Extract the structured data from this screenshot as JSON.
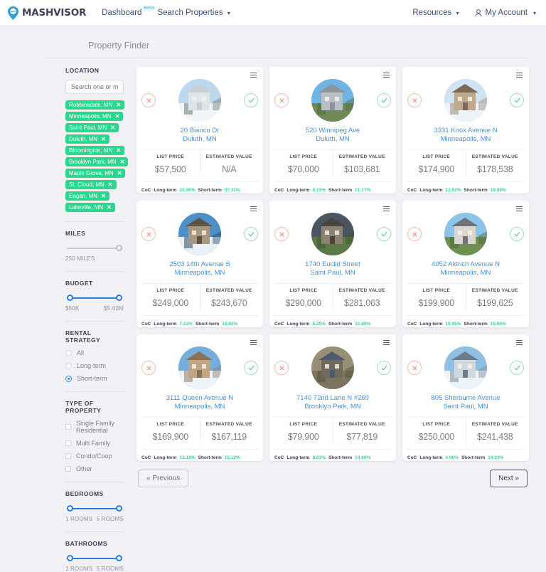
{
  "nav": {
    "brand": "MASHVISOR",
    "brand_icon": "map-pin-icon",
    "links": [
      {
        "label": "Dashboard",
        "badge": "Beta",
        "caret": false
      },
      {
        "label": "Search Properties",
        "badge": "",
        "caret": true
      }
    ],
    "right_links": [
      {
        "label": "Resources",
        "caret": true
      },
      {
        "label": "My Account",
        "caret": true,
        "icon": "person-icon"
      }
    ],
    "caret_glyph": "▾"
  },
  "page": {
    "title": "Property Finder"
  },
  "filters": {
    "location": {
      "label": "Location",
      "search_placeholder": "Search one or multiple ci",
      "search_value": "",
      "chips": [
        "Robbinsdale, MN",
        "Minneapolis, MN",
        "Saint Paul, MN",
        "Duluth, MN",
        "Bloomington, MN",
        "Brooklyn Park, MN",
        "Maple Grove, MN",
        "St. Cloud, MN",
        "Eagan, MN",
        "Lakeville, MN"
      ],
      "chip_remove_glyph": "✕",
      "chip_color": "#2bd68e"
    },
    "miles": {
      "label": "Miles",
      "value_text": "250 MILES"
    },
    "budget": {
      "label": "Budget",
      "min_text": "$50K",
      "max_text": "$5.00M"
    },
    "rental_strategy": {
      "label": "Rental Strategy",
      "options": [
        {
          "label": "All",
          "selected": false
        },
        {
          "label": "Long-term",
          "selected": false
        },
        {
          "label": "Short-term",
          "selected": true
        }
      ]
    },
    "property_type": {
      "label": "Type of Property",
      "options": [
        {
          "label": "Single Family Residential",
          "checked": false
        },
        {
          "label": "Multi Family",
          "checked": false
        },
        {
          "label": "Condo/Coop",
          "checked": false
        },
        {
          "label": "Other",
          "checked": false
        }
      ]
    },
    "bedrooms": {
      "label": "Bedrooms",
      "min_text": "1 ROOMS",
      "max_text": "5 ROOMS"
    },
    "bathrooms": {
      "label": "Bathrooms",
      "min_text": "1 ROOMS",
      "max_text": "5 ROOMS"
    },
    "accent_blue": "#2a7de1"
  },
  "results": {
    "column_headers": {
      "list_price": "LIST PRICE",
      "estimated_value": "ESTIMATED VALUE"
    },
    "coc_label": "CoC",
    "long_term_label": "Long-term",
    "short_term_label": "Short-term",
    "reject_icon": "x-icon",
    "accept_icon": "check-icon",
    "menu_icon": "hamburger-menu-icon",
    "cards": [
      {
        "street": "20 Bianco Dr",
        "city": "Duluth, MN",
        "list_price": "$57,500",
        "estimated_value": "N/A",
        "long_term": "20.96%",
        "short_term": "57.31%",
        "photo": "snowy-ranch-house"
      },
      {
        "street": "520 Winnipeg Ave",
        "city": "Duluth, MN",
        "list_price": "$70,000",
        "estimated_value": "$103,681",
        "long_term": "8.15%",
        "short_term": "21.17%",
        "photo": "grey-two-story-house"
      },
      {
        "street": "3331 Knox Avenue N",
        "city": "Minneapolis, MN",
        "list_price": "$174,900",
        "estimated_value": "$178,538",
        "long_term": "12.92%",
        "short_term": "19.99%",
        "photo": "winter-gabled-house"
      },
      {
        "street": "2503 14th Avenue S",
        "city": "Minneapolis, MN",
        "list_price": "$249,000",
        "estimated_value": "$243,670",
        "long_term": "7.13%",
        "short_term": "15.92%",
        "photo": "snow-tall-house"
      },
      {
        "street": "1740 Euclid Street",
        "city": "Saint Paul, MN",
        "list_price": "$290,000",
        "estimated_value": "$281,063",
        "long_term": "5.25%",
        "short_term": "15.89%",
        "photo": "dusk-modern-home"
      },
      {
        "street": "4052 Aldrich Avenue N",
        "city": "Minneapolis, MN",
        "list_price": "$199,900",
        "estimated_value": "$199,625",
        "long_term": "10.95%",
        "short_term": "15.69%",
        "photo": "white-duplex-lawn"
      },
      {
        "street": "3111 Queen Avenue N",
        "city": "Minneapolis, MN",
        "list_price": "$169,900",
        "estimated_value": "$167,119",
        "long_term": "13.18%",
        "short_term": "15.12%",
        "photo": "snow-craftsman"
      },
      {
        "street": "7140 72nd Lane N #269",
        "city": "Brooklyn Park, MN",
        "list_price": "$79,900",
        "estimated_value": "$77,819",
        "long_term": "8.63%",
        "short_term": "14.60%",
        "photo": "blue-door-entry"
      },
      {
        "street": "805 Sherburne Avenue",
        "city": "Saint Paul, MN",
        "list_price": "$250,000",
        "estimated_value": "$241,438",
        "long_term": "4.90%",
        "short_term": "14.03%",
        "photo": "snow-victorian"
      }
    ]
  },
  "pagination": {
    "previous": "« Previous",
    "next": "Next »"
  }
}
